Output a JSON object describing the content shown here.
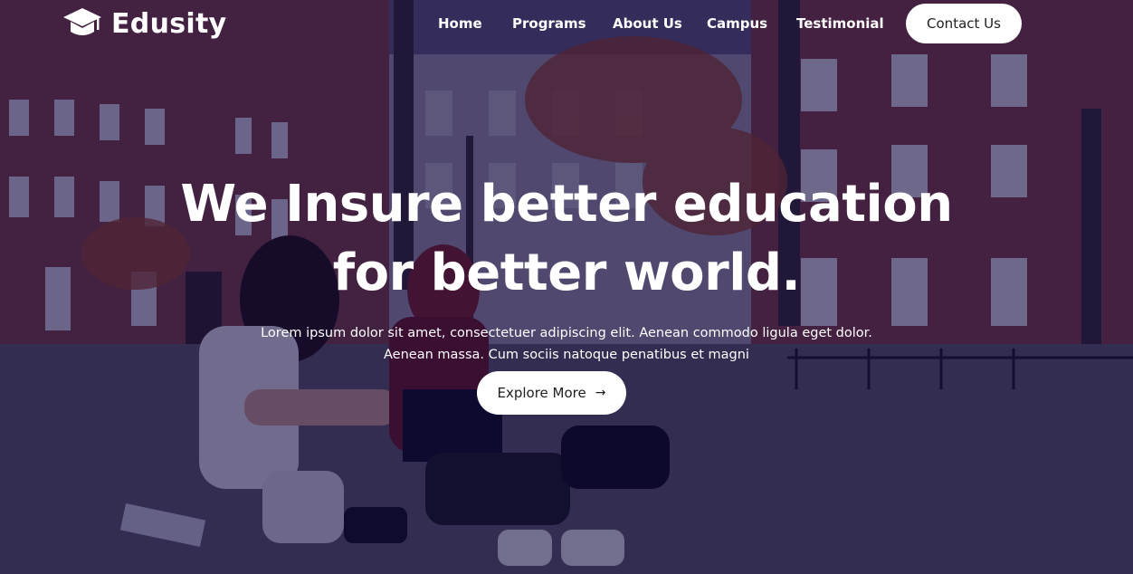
{
  "brand": {
    "name": "Edusity",
    "icon": "graduation-cap-icon"
  },
  "nav": {
    "items": [
      {
        "label": "Home"
      },
      {
        "label": "Programs"
      },
      {
        "label": "About Us"
      },
      {
        "label": "Campus"
      },
      {
        "label": "Testimonial"
      }
    ],
    "contact_label": "Contact Us"
  },
  "hero": {
    "title_line1": "We Insure better education",
    "title_line2": "for better world.",
    "description_line1": "Lorem ipsum dolor sit amet, consectetuer adipiscing elit. Aenean commodo ligula eget dolor.",
    "description_line2": "Aenean massa. Cum sociis natoque penatibus et magni",
    "cta_label": "Explore More",
    "cta_icon": "arrow-right-icon"
  },
  "colors": {
    "overlay": "#08003a",
    "button_bg": "#ffffff",
    "button_text": "#212121",
    "text": "#ffffff"
  }
}
